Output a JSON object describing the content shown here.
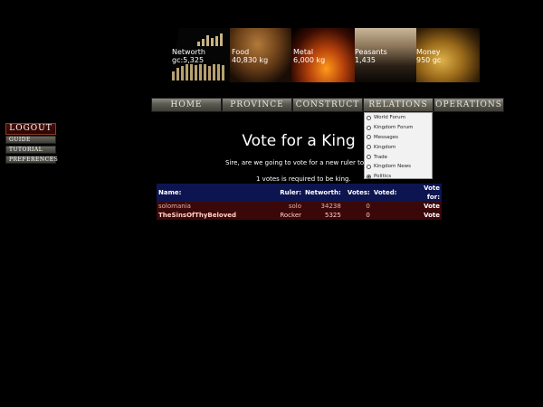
{
  "stats": {
    "networth": {
      "label": "Networth",
      "value": "gc:5,325"
    },
    "food": {
      "label": "Food",
      "value": "40,830 kg"
    },
    "metal": {
      "label": "Metal",
      "value": "6,000 kg"
    },
    "peasants": {
      "label": "Peasants",
      "value": "1,435"
    },
    "money": {
      "label": "Money",
      "value": "950 gc"
    }
  },
  "nav": {
    "items": [
      "HOME",
      "PROVINCE",
      "CONSTRUCT",
      "RELATIONS",
      "OPERATIONS"
    ]
  },
  "dropdown": {
    "items": [
      "World Forum",
      "Kingdom Forum",
      "Messages",
      "Kingdom",
      "Trade",
      "Kingdom News",
      "Politics"
    ],
    "selected": "Politics"
  },
  "side": {
    "logout": "LOGOUT",
    "guide": "GUIDE",
    "tutorial": "TUTORIAL",
    "preferences": "PREFERENCES"
  },
  "main": {
    "title": "Vote for a King",
    "subtitle": "Sire, are we going to vote for a new ruler tod",
    "required": "1 votes is required to be king."
  },
  "table": {
    "headers": [
      "Name:",
      "Ruler:",
      "Networth:",
      "Votes:",
      "Voted:",
      "Vote for:"
    ],
    "rows": [
      {
        "name": "solomania",
        "ruler": "solo",
        "networth": "34238",
        "votes": "0",
        "voted": "",
        "action": "Vote"
      },
      {
        "name": "TheSinsOfThyBeloved",
        "ruler": "Rocker",
        "networth": "5325",
        "votes": "0",
        "voted": "",
        "action": "Vote"
      }
    ]
  }
}
